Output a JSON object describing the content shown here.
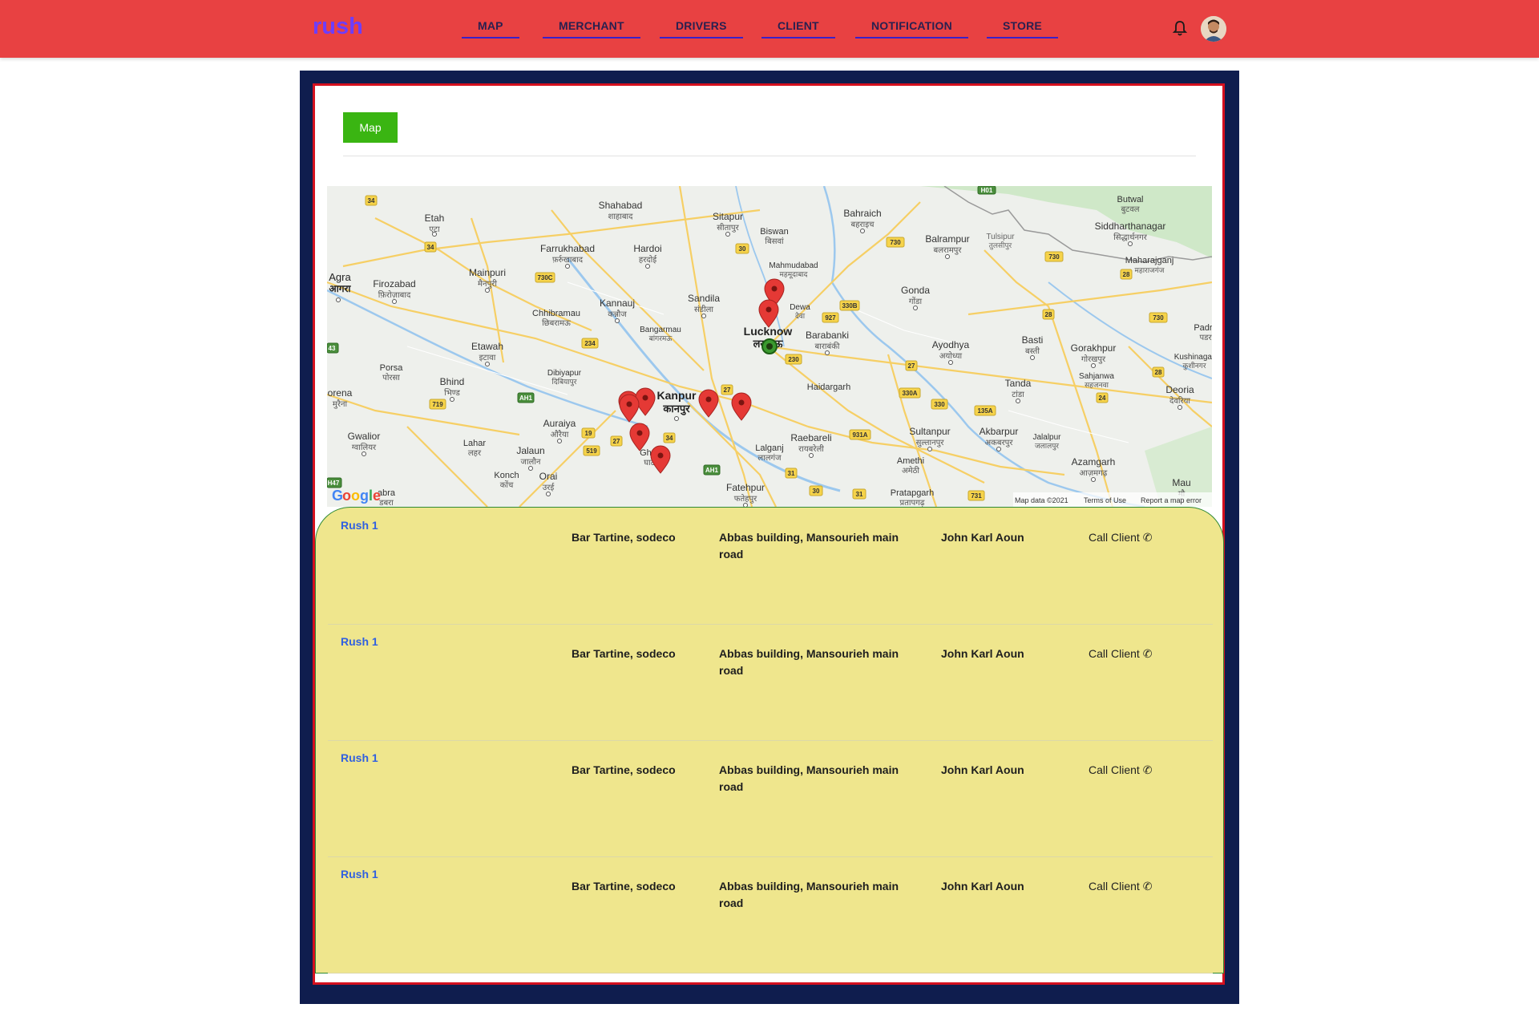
{
  "app": {
    "brand": "rush"
  },
  "nav": {
    "items": [
      "MAP",
      "MERCHANT",
      "DRIVERS",
      "CLIENT",
      "NOTIFICATION",
      "STORE"
    ]
  },
  "header": {
    "icons": [
      "bell-icon",
      "user-avatar"
    ]
  },
  "panel": {
    "map_button_label": "Map"
  },
  "map": {
    "cities": [
      {
        "name": "Etah",
        "local": "एटा"
      },
      {
        "name": "Agra",
        "local": "आगरा"
      },
      {
        "name": "Firozabad",
        "local": "फ़िरोज़ाबाद"
      },
      {
        "name": "Mainpuri",
        "local": "मैनपुरी"
      },
      {
        "name": "Farrukhabad",
        "local": "फ़र्रुखाबाद"
      },
      {
        "name": "Hardoi",
        "local": "हरदोई"
      },
      {
        "name": "Shahabad",
        "local": "शाहाबाद"
      },
      {
        "name": "Sitapur",
        "local": "सीतापुर"
      },
      {
        "name": "Biswan",
        "local": "बिसवां"
      },
      {
        "name": "Bahraich",
        "local": "बहराइच"
      },
      {
        "name": "Balrampur",
        "local": "बलरामपुर"
      },
      {
        "name": "Tulsipur",
        "local": "तुलसीपुर"
      },
      {
        "name": "Siddharthanagar",
        "local": "सिद्धार्थनगर"
      },
      {
        "name": "Butwal",
        "local": "बुटवल"
      },
      {
        "name": "Maharajganj",
        "local": "महाराजगंज"
      },
      {
        "name": "Mahmudabad",
        "local": "महमूदाबाद"
      },
      {
        "name": "Kannauj",
        "local": "कन्नौज"
      },
      {
        "name": "Sandila",
        "local": "संडीला"
      },
      {
        "name": "Gonda",
        "local": "गोंडा"
      },
      {
        "name": "Chhibramau",
        "local": "छिबरामऊ"
      },
      {
        "name": "Dewa",
        "local": "देवा"
      },
      {
        "name": "Lucknow",
        "local": "लखनऊ"
      },
      {
        "name": "Barabanki",
        "local": "बाराबंकी"
      },
      {
        "name": "Basti",
        "local": "बस्ती"
      },
      {
        "name": "Padrauna",
        "local": "पडरौना"
      },
      {
        "name": "Etawah",
        "local": "इटावा"
      },
      {
        "name": "Bangarmau",
        "local": "बांगरमऊ"
      },
      {
        "name": "Ayodhya",
        "local": "अयोध्या"
      },
      {
        "name": "Gorakhpur",
        "local": "गोरखपुर"
      },
      {
        "name": "Kushinagar",
        "local": "कुशीनगर"
      },
      {
        "name": "Porsa",
        "local": "पोरसा"
      },
      {
        "name": "Dibiyapur",
        "local": "दिबियापुर"
      },
      {
        "name": "Bhind",
        "local": "भिण्ड"
      },
      {
        "name": "Kanpur",
        "local": "कानपुर"
      },
      {
        "name": "Haidargarh",
        "local": ""
      },
      {
        "name": "Tanda",
        "local": "टांडा"
      },
      {
        "name": "Sahjanwa",
        "local": "सहजनवा"
      },
      {
        "name": "Deoria",
        "local": "देवरिया"
      },
      {
        "name": "Morena",
        "local": "मुरैना"
      },
      {
        "name": "Auraiya",
        "local": "औरैया"
      },
      {
        "name": "Gwalior",
        "local": "ग्वालियर"
      },
      {
        "name": "Lahar",
        "local": "लहर"
      },
      {
        "name": "Jalaun",
        "local": "जालौन"
      },
      {
        "name": "Raebareli",
        "local": "रायबरेली"
      },
      {
        "name": "Sultanpur",
        "local": "सुल्तानपुर"
      },
      {
        "name": "Akbarpur",
        "local": "अकबरपुर"
      },
      {
        "name": "Jalalpur",
        "local": "जलालपुर"
      },
      {
        "name": "Lalganj",
        "local": "लालगंज"
      },
      {
        "name": "Amethi",
        "local": "अमेठी"
      },
      {
        "name": "Azamgarh",
        "local": "आज़मगढ़"
      },
      {
        "name": "Konch",
        "local": "कोंच"
      },
      {
        "name": "Orai",
        "local": "उरई"
      },
      {
        "name": "Fatehpur",
        "local": "फतेहपुर"
      },
      {
        "name": "Pratapgarh",
        "local": "प्रतापगढ़"
      },
      {
        "name": "Mau",
        "local": "मौ"
      },
      {
        "name": "Dabra",
        "local": "डबरा"
      },
      {
        "name": "Ghatampur",
        "local": "घाटमपुर"
      }
    ],
    "attribution": [
      "Map data ©2021",
      "Terms of Use",
      "Report a map error"
    ],
    "logo": "Google"
  },
  "orders": [
    {
      "name": "Rush 1",
      "place": "Bar Tartine, sodeco",
      "address": "Abbas building, Mansourieh main road",
      "person": "John Karl Aoun",
      "action": "Call Client"
    },
    {
      "name": "Rush 1",
      "place": "Bar Tartine, sodeco",
      "address": "Abbas building, Mansourieh main road",
      "person": "John Karl Aoun",
      "action": "Call Client"
    },
    {
      "name": "Rush 1",
      "place": "Bar Tartine, sodeco",
      "address": "Abbas building, Mansourieh main road",
      "person": "John Karl Aoun",
      "action": "Call Client"
    },
    {
      "name": "Rush 1",
      "place": "Bar Tartine, sodeco",
      "address": "Abbas building, Mansourieh main road",
      "person": "John Karl Aoun",
      "action": "Call Client"
    }
  ],
  "colors": {
    "topbar": "#e84142",
    "brand": "#6d3dff",
    "frame": "#0f1d4e",
    "frame_border": "#d4101e",
    "map_button": "#3ab512",
    "list_background": "#efe68d",
    "marker": "#e53935"
  }
}
